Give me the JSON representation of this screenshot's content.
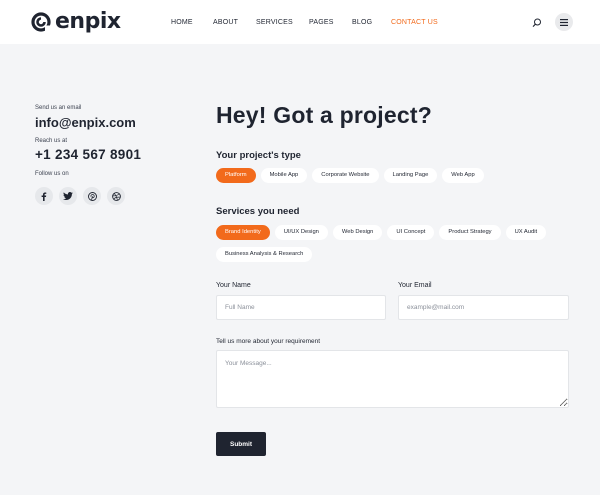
{
  "brand": {
    "name": "enpix",
    "accent": "#f26a1b",
    "dark": "#1f2430"
  },
  "nav": {
    "items": [
      {
        "label": "HOME"
      },
      {
        "label": "ABOUT"
      },
      {
        "label": "SERVICES"
      },
      {
        "label": "PAGES"
      },
      {
        "label": "BLOG"
      },
      {
        "label": "CONTACT US",
        "active": true
      }
    ],
    "search_icon": "search-icon",
    "menu_icon": "menu-icon"
  },
  "contact": {
    "email_label": "Send us an email",
    "email": "info@enpix.com",
    "phone_label": "Reach us at",
    "phone": "+1 234 567 8901",
    "follow_label": "Follow us on",
    "socials": [
      {
        "name": "facebook-icon",
        "glyph": "f"
      },
      {
        "name": "twitter-icon",
        "glyph": "t"
      },
      {
        "name": "pinterest-icon",
        "glyph": "P"
      },
      {
        "name": "dribbble-icon",
        "glyph": "d"
      }
    ]
  },
  "form": {
    "heading": "Hey! Got a project?",
    "project_type": {
      "title": "Your project's type",
      "options": [
        "Platform",
        "Mobile App",
        "Corporate Website",
        "Landing Page",
        "Web App"
      ],
      "selected": "Platform"
    },
    "services": {
      "title": "Services you need",
      "options": [
        "Brand Identity",
        "UI/UX Design",
        "Web Design",
        "UI Concept",
        "Product Strategy",
        "UX Audit",
        "Business Analysis & Research"
      ],
      "selected": "Brand Identity"
    },
    "name": {
      "label": "Your Name",
      "placeholder": "Full Name",
      "value": ""
    },
    "email": {
      "label": "Your Email",
      "placeholder": "example@mail.com",
      "value": ""
    },
    "message": {
      "label": "Tell us more about your requirement",
      "placeholder": "Your Message...",
      "value": ""
    },
    "submit_label": "Submit"
  }
}
